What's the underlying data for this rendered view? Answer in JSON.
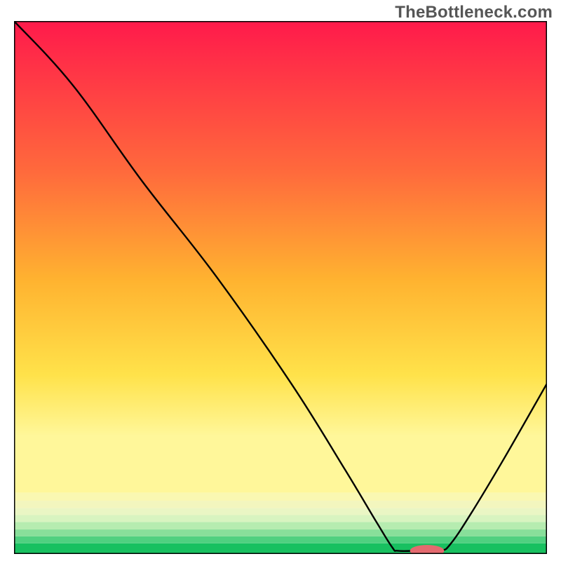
{
  "watermark": "TheBottleneck.com",
  "chart_data": {
    "type": "line",
    "title": "",
    "xlabel": "",
    "ylabel": "",
    "xlim": [
      0,
      100
    ],
    "ylim": [
      0,
      100
    ],
    "curve": [
      {
        "x": 0,
        "y": 100
      },
      {
        "x": 11,
        "y": 88
      },
      {
        "x": 24,
        "y": 70
      },
      {
        "x": 38,
        "y": 52
      },
      {
        "x": 52,
        "y": 32
      },
      {
        "x": 62,
        "y": 16
      },
      {
        "x": 68,
        "y": 6
      },
      {
        "x": 71,
        "y": 1.2
      },
      {
        "x": 72,
        "y": 0.6
      },
      {
        "x": 76,
        "y": 0.6
      },
      {
        "x": 80,
        "y": 0.6
      },
      {
        "x": 82,
        "y": 2
      },
      {
        "x": 86,
        "y": 8
      },
      {
        "x": 92,
        "y": 18
      },
      {
        "x": 100,
        "y": 32
      }
    ],
    "marker": {
      "x": 77.5,
      "y": 0.6,
      "rx": 3.2,
      "ry": 1.1
    },
    "background_bands": [
      {
        "from": 0,
        "to": 2,
        "color": "#18c060"
      },
      {
        "from": 2,
        "to": 3.3,
        "color": "#50d080"
      },
      {
        "from": 3.3,
        "to": 4.6,
        "color": "#88df9a"
      },
      {
        "from": 4.6,
        "to": 6,
        "color": "#b6ecb0"
      },
      {
        "from": 6,
        "to": 7.3,
        "color": "#d8f4c0"
      },
      {
        "from": 7.3,
        "to": 8.6,
        "color": "#eaf6c4"
      },
      {
        "from": 8.6,
        "to": 10,
        "color": "#f3f6be"
      },
      {
        "from": 10,
        "to": 11.5,
        "color": "#faf8b2"
      }
    ],
    "gradient_stops": [
      {
        "pct": 0,
        "color": "#ff1a4b"
      },
      {
        "pct": 32,
        "color": "#ff6a3c"
      },
      {
        "pct": 55,
        "color": "#ffb330"
      },
      {
        "pct": 75,
        "color": "#ffe24a"
      },
      {
        "pct": 88,
        "color": "#fff79a"
      }
    ],
    "colors": {
      "line": "#000000",
      "marker_fill": "#e46a6f",
      "frame": "#000000"
    }
  }
}
